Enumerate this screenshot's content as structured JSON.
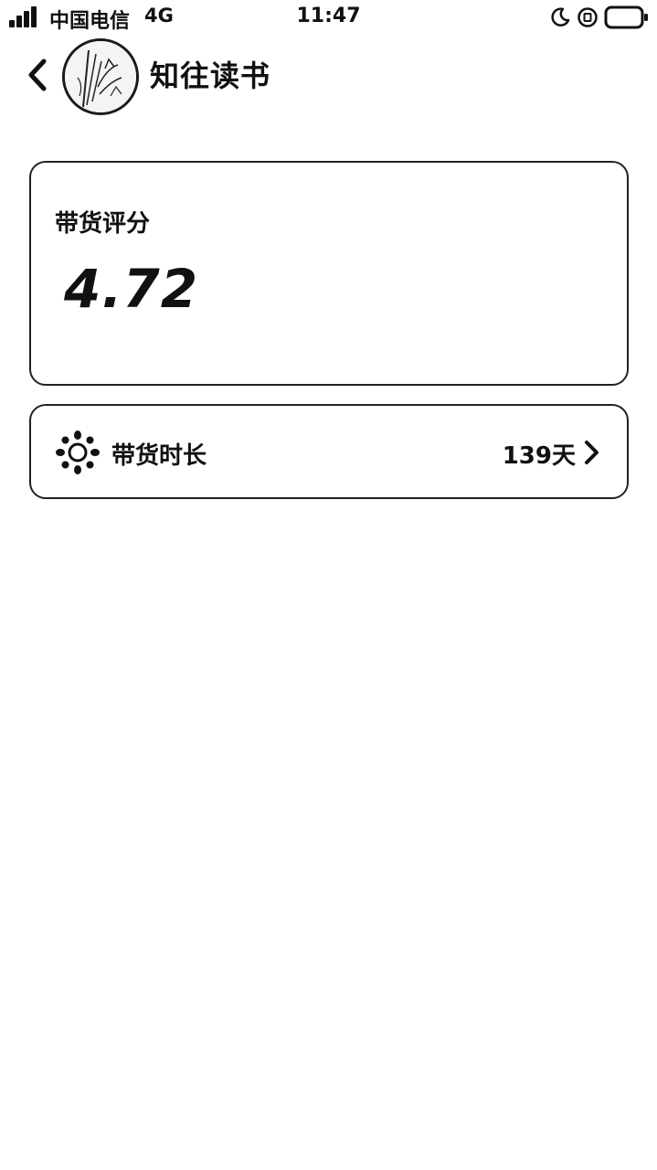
{
  "status_bar": {
    "carrier": "中国电信",
    "network": "4G",
    "time": "11:47",
    "icons": [
      "signal-icon",
      "moon-icon",
      "orientation-lock-icon",
      "battery-icon"
    ]
  },
  "header": {
    "shop_name": "知往读书",
    "icons": [
      "back-arrow-icon",
      "avatar"
    ]
  },
  "score_card": {
    "label": "带货评分",
    "value": "4.72"
  },
  "duration_card": {
    "label": "带货时长",
    "value": "139天",
    "icons": [
      "sun-icon",
      "chevron-right-icon"
    ]
  }
}
